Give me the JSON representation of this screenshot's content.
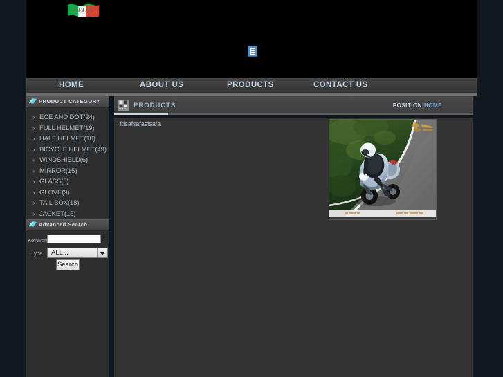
{
  "site": {
    "logo_text": "GELIN",
    "logo_alt": "italian-flag-logo"
  },
  "nav": {
    "items": [
      {
        "label": "HOME"
      },
      {
        "label": "ABOUT US"
      },
      {
        "label": "PRODUCTS"
      },
      {
        "label": "CONTACT US"
      }
    ]
  },
  "sidebar": {
    "category_panel": {
      "title": "PRODUCT CATEGORY",
      "items": [
        {
          "label": "ECE AND DOT(24)"
        },
        {
          "label": "FULL HELMET(19)"
        },
        {
          "label": "HALF HELMET(10)"
        },
        {
          "label": "BICYCLE HELMET(49)"
        },
        {
          "label": "WINDSHIELD(6)"
        },
        {
          "label": "MIRROR(15)"
        },
        {
          "label": "GLASS(5)"
        },
        {
          "label": "GLOVE(9)"
        },
        {
          "label": "TAIL BOX(18)"
        },
        {
          "label": "JACKET(13)"
        }
      ]
    },
    "search_panel": {
      "title": "Advanced Search",
      "keyword_label": "KeyWord",
      "keyword_value": "",
      "keyword_placeholder": "",
      "type_label": "Type",
      "type_selected": "ALL...",
      "type_options": [
        "ALL..."
      ],
      "search_button": "Search"
    }
  },
  "content": {
    "breadcrumb": {
      "title": "PRODUCTS",
      "position_label": "POSITION",
      "position_value": "HOME"
    },
    "product": {
      "title": "fdsafsafasfsafa",
      "image_alt": "motorcycle-on-road-photo"
    }
  },
  "colors": {
    "page_background": "#121820",
    "banner": "#000000",
    "nav_bar": "#3a3a3a",
    "panel": "#2e2e2e",
    "content_panel": "#333333",
    "link_blue": "#7fa8d8",
    "accent_cyan": "#5fd8e8"
  }
}
